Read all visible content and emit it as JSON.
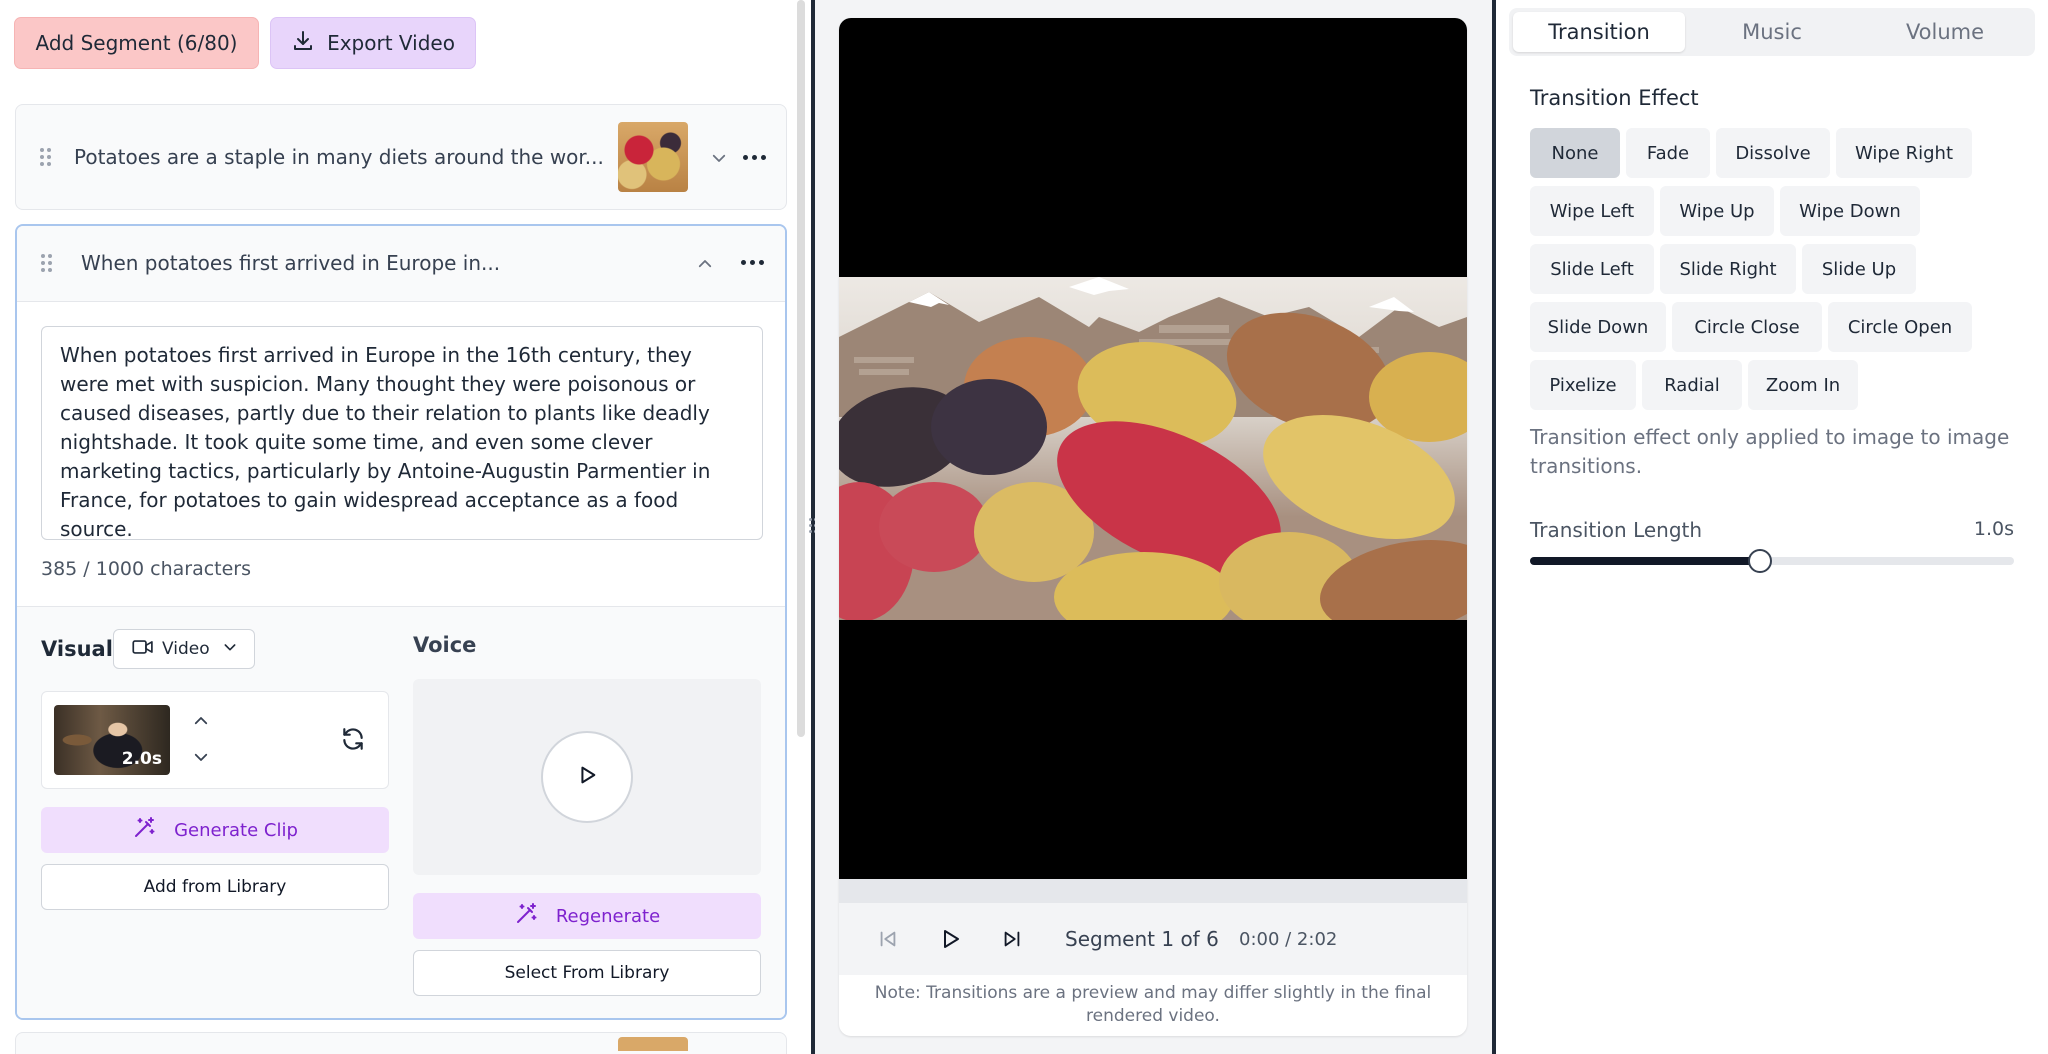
{
  "toolbar": {
    "add_segment_label": "Add Segment (6/80)",
    "export_label": "Export Video"
  },
  "segments": [
    {
      "title": "Potatoes are a staple in many diets around the wor...",
      "expanded": false
    },
    {
      "title": "When potatoes first arrived in Europe in...",
      "expanded": true,
      "text": "When potatoes first arrived in Europe in the 16th century, they were met with suspicion. Many thought they were poisonous or caused diseases, partly due to their relation to plants like deadly nightshade. It took quite some time, and even some clever marketing tactics, particularly by Antoine-Augustin Parmentier in France, for potatoes to gain widespread acceptance as a food source.",
      "char_count": "385 / 1000 characters",
      "visual_label": "Visual",
      "visual_type": "Video",
      "clip_duration": "2.0s",
      "generate_clip_label": "Generate Clip",
      "add_from_library_label": "Add from Library",
      "voice_label": "Voice",
      "regenerate_label": "Regenerate",
      "select_from_library_label": "Select From Library"
    }
  ],
  "player": {
    "segment_info": "Segment 1 of 6",
    "time": "0:00 / 2:02",
    "note": "Note: Transitions are a preview and may differ slightly in the final rendered video."
  },
  "tabs": [
    {
      "label": "Transition",
      "active": true
    },
    {
      "label": "Music",
      "active": false
    },
    {
      "label": "Volume",
      "active": false
    }
  ],
  "transition": {
    "effect_label": "Transition Effect",
    "selected": "None",
    "effects": [
      "None",
      "Fade",
      "Dissolve",
      "Wipe Right",
      "Wipe Left",
      "Wipe Up",
      "Wipe Down",
      "Slide Left",
      "Slide Right",
      "Slide Up",
      "Slide Down",
      "Circle Close",
      "Circle Open",
      "Pixelize",
      "Radial",
      "Zoom In"
    ],
    "note": "Transition effect only applied to image to image transitions.",
    "length_label": "Transition Length",
    "length_value": "1.0s",
    "length_fraction": 0.475
  },
  "colors": {
    "add_segment_bg": "#fbc7c7",
    "export_bg": "#e8d5fb",
    "accent_purple": "#7e22ce",
    "selected_effect_bg": "#d1d5db"
  },
  "icons": {
    "export": "download-icon",
    "drag": "grip-icon",
    "expand": "chevron-down-icon",
    "collapse": "chevron-up-icon",
    "more": "more-horizontal-icon",
    "video": "video-camera-icon",
    "refresh": "refresh-icon",
    "magic": "magic-wand-icon",
    "play": "play-icon",
    "skip_back": "skip-back-icon",
    "skip_forward": "skip-forward-icon"
  }
}
